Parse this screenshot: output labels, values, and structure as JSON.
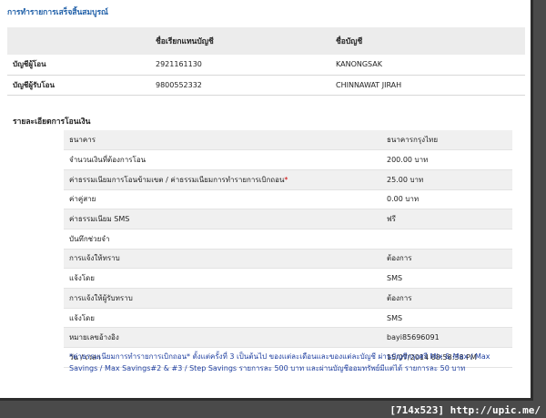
{
  "page_title": "การทำรายการเสร็จสิ้นสมบูรณ์",
  "accounts": {
    "headers": [
      "",
      "ชื่อเรียกแทนบัญชี",
      "ชื่อบัญชี"
    ],
    "rows": [
      {
        "label": "บัญชีผู้โอน",
        "number": "2921161130",
        "name": "KANONGSAK"
      },
      {
        "label": "บัญชีผู้รับโอน",
        "number": "9800552332",
        "name": "CHINNAWAT JIRAH"
      }
    ]
  },
  "details_title": "รายละเอียดการโอนเงิน",
  "details": [
    {
      "label": "ธนาคาร",
      "value": "ธนาคารกรุงไทย"
    },
    {
      "label": "จำนวนเงินที่ต้องการโอน",
      "value": "200.00 บาท"
    },
    {
      "label": "ค่าธรรมเนียมการโอนข้ามเขต / ค่าธรรมเนียมการทำรายการเบิกถอน",
      "value": "25.00 บาท"
    },
    {
      "label": "ค่าคู่สาย",
      "value": "0.00 บาท"
    },
    {
      "label": "ค่าธรรมเนียม SMS",
      "value": "ฟรี"
    },
    {
      "label": "บันทึกช่วยจำ",
      "value": ""
    },
    {
      "label": "การแจ้งให้ทราบ",
      "value": "ต้องการ"
    },
    {
      "label": "แจ้งโดย",
      "value": "SMS"
    },
    {
      "label": "การแจ้งให้ผู้รับทราบ",
      "value": "ต้องการ"
    },
    {
      "label": "แจ้งโดย",
      "value": "SMS"
    },
    {
      "label": "หมายเลขอ้างอิง",
      "value": "bayi85696091"
    },
    {
      "label": "วัน / เวลา",
      "value": "15/07/2014 08:58:38 PM"
    }
  ],
  "asterisk": "*",
  "note": "*ค่าธรรมเนียมการทำรายการเบิกถอน* ตั้งแต่ครั้งที่ 3 เป็นต้นไป ของแต่ละเดือนและของแต่ละบัญชี ผ่านบัญชีกรุงศรี Mix & Max / Max Savings / Max Savings#2 & #3 / Step Savings รายการละ 500 บาท และผ่านบัญชีออมทรัพย์มีแต่ได้ รายการละ 50 บาท",
  "footer": "[714x523] http://upic.me/",
  "colors": {
    "accent": "#1f5fa8",
    "asterisk": "#cc0000",
    "note": "#1f3fa0"
  }
}
